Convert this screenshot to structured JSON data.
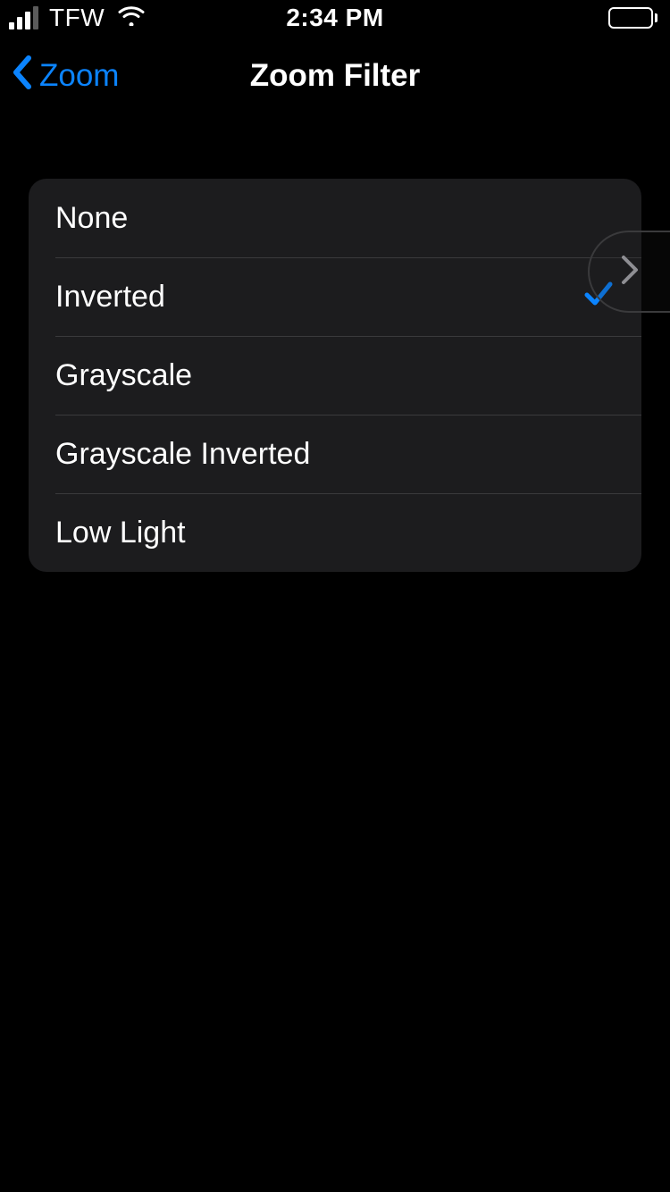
{
  "status_bar": {
    "carrier": "TFW",
    "time": "2:34 PM"
  },
  "nav": {
    "back_label": "Zoom",
    "title": "Zoom Filter"
  },
  "filters": {
    "selected_index": 1,
    "items": [
      {
        "label": "None"
      },
      {
        "label": "Inverted"
      },
      {
        "label": "Grayscale"
      },
      {
        "label": "Grayscale Inverted"
      },
      {
        "label": "Low Light"
      }
    ]
  }
}
